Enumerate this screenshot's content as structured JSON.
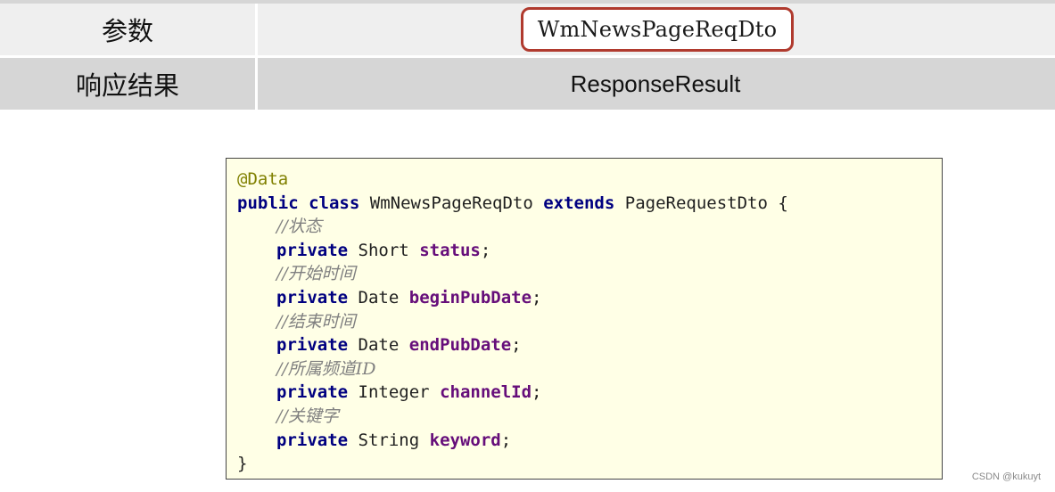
{
  "table": {
    "params_label": "参数",
    "params_value": "WmNewsPageReqDto",
    "response_label": "响应结果",
    "response_value": "ResponseResult"
  },
  "code": {
    "annotation": "@Data",
    "class_decl": {
      "kw_public": "public",
      "kw_class": "class",
      "class_name": "WmNewsPageReqDto",
      "kw_extends": "extends",
      "super_name": "PageRequestDto",
      "open_brace": "{"
    },
    "fields": [
      {
        "comment": "//状态",
        "modifier": "private",
        "type": "Short",
        "name": "status"
      },
      {
        "comment": "//开始时间",
        "modifier": "private",
        "type": "Date",
        "name": "beginPubDate"
      },
      {
        "comment": "//结束时间",
        "modifier": "private",
        "type": "Date",
        "name": "endPubDate"
      },
      {
        "comment": "//所属频道ID",
        "modifier": "private",
        "type": "Integer",
        "name": "channelId"
      },
      {
        "comment": "//关键字",
        "modifier": "private",
        "type": "String",
        "name": "keyword"
      }
    ],
    "close_brace": "}"
  },
  "watermark": "CSDN @kukuyt",
  "colors": {
    "highlight_border": "#b03a2e",
    "code_background": "#ffffe6",
    "keyword": "#000080",
    "annotation": "#808000",
    "field": "#660e7a",
    "comment": "#808080"
  }
}
